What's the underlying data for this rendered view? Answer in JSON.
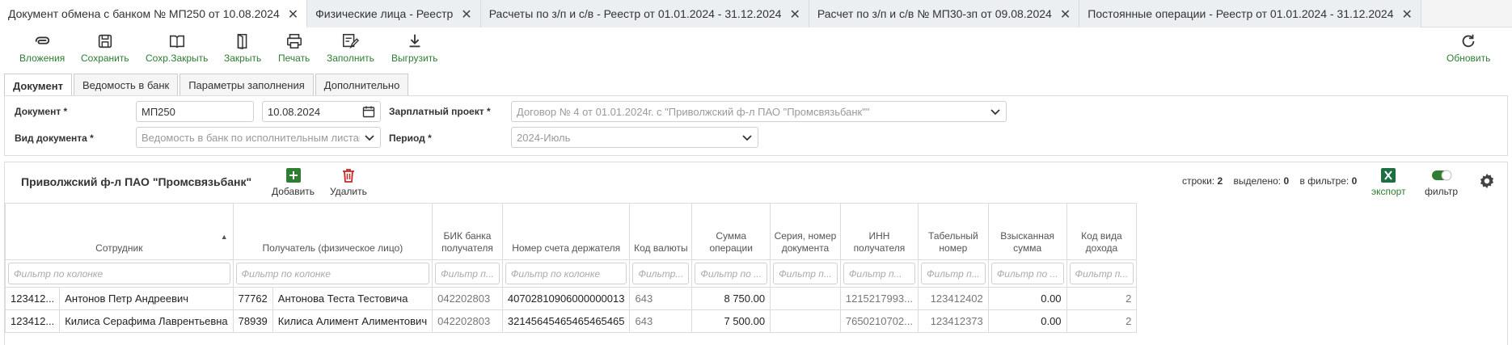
{
  "doc_tabs": [
    {
      "label": "Документ обмена с банком № МП250 от 10.08.2024",
      "active": true
    },
    {
      "label": "Физические лица - Реестр",
      "active": false
    },
    {
      "label": "Расчеты по з/п и с/в - Реестр от 01.01.2024 - 31.12.2024",
      "active": false
    },
    {
      "label": "Расчет по з/п и с/в № МП30-зп от 09.08.2024",
      "active": false
    },
    {
      "label": "Постоянные операции - Реестр от 01.01.2024 - 31.12.2024",
      "active": false
    }
  ],
  "toolbar": {
    "attachments": "Вложения",
    "save": "Сохранить",
    "save_close": "Сохр.Закрыть",
    "close": "Закрыть",
    "print": "Печать",
    "fill": "Заполнить",
    "export": "Выгрузить",
    "refresh": "Обновить"
  },
  "form_tabs": [
    "Документ",
    "Ведомость в банк",
    "Параметры заполнения",
    "Дополнительно"
  ],
  "form": {
    "document_label": "Документ *",
    "document_number": "МП250",
    "document_date": "10.08.2024",
    "salary_project_label": "Зарплатный проект *",
    "salary_project_value": "Договор № 4 от 01.01.2024г. с \"Приволжский ф-л ПАО \"Промсвязьбанк\"\"",
    "doc_type_label": "Вид документа *",
    "doc_type_value": "Ведомость в банк по исполнительным листам",
    "period_label": "Период *",
    "period_value": "2024-Июль"
  },
  "grid": {
    "title": "Приволжский ф-л ПАО \"Промсвязьбанк\"",
    "add": "Добавить",
    "delete": "Удалить",
    "rows_label": "строки:",
    "rows_count": "2",
    "selected_label": "выделено:",
    "selected_count": "0",
    "in_filter_label": "в фильтре:",
    "in_filter_count": "0",
    "export_label": "экспорт",
    "filter_label": "фильтр",
    "columns": [
      "Сотрудник",
      "Получатель (физическое лицо)",
      "БИК банка получателя",
      "Номер счета держателя",
      "Код валюты",
      "Сумма операции",
      "Серия, номер документа",
      "ИНН получателя",
      "Табельный номер",
      "Взысканная сумма",
      "Код вида дохода"
    ],
    "filters": [
      "Фильтр по колонке",
      "Фильтр по колонке",
      "Фильтр п...",
      "Фильтр по колонке",
      "Фильтр...",
      "Фильтр по ...",
      "Фильтр п...",
      "Фильтр п...",
      "Фильтр п...",
      "Фильтр по ...",
      "Фильтр п..."
    ],
    "rows": [
      {
        "emp_code": "123412...",
        "emp_name": "Антонов Петр Андреевич",
        "rec_code": "77762",
        "rec_name": "Антонова Теста Тестовича",
        "bik": "042202803",
        "account": "40702810906000000013",
        "currency": "643",
        "amount": "8 750.00",
        "doc_series": "",
        "inn": "1215217993...",
        "tab_no": "123412402",
        "recovered": "0.00",
        "income_code": "2"
      },
      {
        "emp_code": "123412...",
        "emp_name": "Килиса Серафима Лаврентьевна",
        "rec_code": "78939",
        "rec_name": "Килиса Алимент Алиментович",
        "bik": "042202803",
        "account": "32145645465465465465",
        "currency": "643",
        "amount": "7 500.00",
        "doc_series": "",
        "inn": "7650210702...",
        "tab_no": "123412373",
        "recovered": "0.00",
        "income_code": "2"
      }
    ]
  },
  "colors": {
    "accent_green": "#2e7d32",
    "delete_red": "#c62828",
    "excel_green": "#1d6f42"
  }
}
